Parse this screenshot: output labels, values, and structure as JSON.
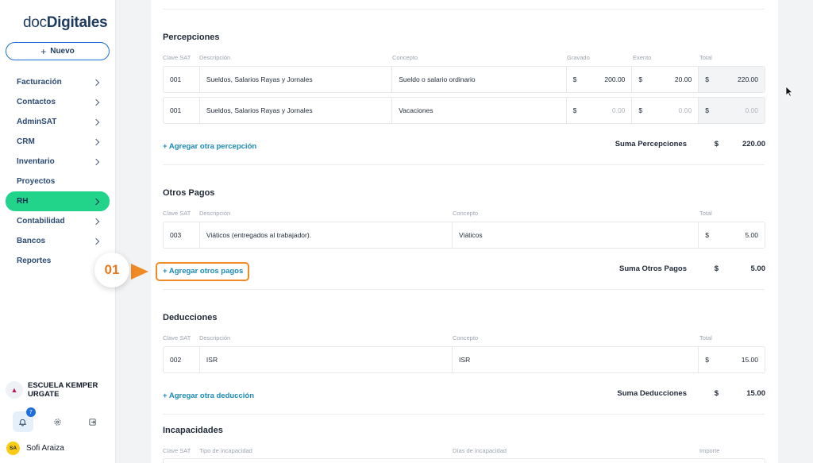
{
  "app": {
    "logo_light": "doc",
    "logo_bold": "Digitales"
  },
  "sidebar": {
    "new_button": "Nuevo",
    "items": [
      {
        "label": "Facturación",
        "chevron": true
      },
      {
        "label": "Contactos",
        "chevron": true
      },
      {
        "label": "AdminSAT",
        "chevron": true
      },
      {
        "label": "CRM",
        "chevron": true
      },
      {
        "label": "Inventario",
        "chevron": true
      },
      {
        "label": "Proyectos",
        "chevron": false
      },
      {
        "label": "RH",
        "chevron": true,
        "active": true
      },
      {
        "label": "Contabilidad",
        "chevron": true
      },
      {
        "label": "Bancos",
        "chevron": true
      },
      {
        "label": "Reportes",
        "chevron": false
      }
    ],
    "org_name_line1": "ESCUELA KEMPER",
    "org_name_line2": "URGATE",
    "notifications_count": "7",
    "user_initials": "SA",
    "user_name": "Sofi Araiza"
  },
  "percepciones": {
    "title": "Percepciones",
    "headers": {
      "clave": "Clave SAT",
      "descripcion": "Descripción",
      "concepto": "Concepto",
      "gravado": "Gravado",
      "exento": "Exento",
      "total": "Total"
    },
    "rows": [
      {
        "clave": "001",
        "descripcion": "Sueldos, Salarios Rayas y Jornales",
        "concepto": "Sueldo o salario ordinario",
        "currency": "$",
        "gravado": "200.00",
        "exento": "20.00",
        "total": "220.00"
      },
      {
        "clave": "001",
        "descripcion": "Sueldos, Salarios Rayas y Jornales",
        "concepto": "Vacaciones",
        "currency": "$",
        "gravado": "0.00",
        "exento": "0.00",
        "total": "0.00"
      }
    ],
    "add_link": "+ Agregar otra percepción",
    "sum_label": "Suma Percepciones",
    "sum_currency": "$",
    "sum_value": "220.00"
  },
  "otros_pagos": {
    "title": "Otros Pagos",
    "headers": {
      "clave": "Clave SAT",
      "descripcion": "Descripción",
      "concepto": "Concepto",
      "total": "Total"
    },
    "rows": [
      {
        "clave": "003",
        "descripcion": "Viáticos (entregados al trabajador).",
        "concepto": "Viáticos",
        "currency": "$",
        "total": "5.00"
      }
    ],
    "add_link": "+ Agregar otros pagos",
    "sum_label": "Suma Otros Pagos",
    "sum_currency": "$",
    "sum_value": "5.00"
  },
  "deducciones": {
    "title": "Deducciones",
    "headers": {
      "clave": "Clave SAT",
      "descripcion": "Descripción",
      "concepto": "Concepto",
      "total": "Total"
    },
    "rows": [
      {
        "clave": "002",
        "descripcion": "ISR",
        "concepto": "ISR",
        "currency": "$",
        "total": "15.00"
      }
    ],
    "add_link": "+ Agregar otra deducción",
    "sum_label": "Suma Deducciones",
    "sum_currency": "$",
    "sum_value": "15.00"
  },
  "incapacidades": {
    "title": "Incapacidades",
    "headers": {
      "clave": "Clave SAT",
      "tipo": "Tipo de incapacidad",
      "dias": "Días de incapacidad",
      "importe": "Importe"
    }
  },
  "callout": {
    "step": "01"
  },
  "colors": {
    "accent_green": "#22d38a",
    "link_blue": "#1b8ab8",
    "callout_orange": "#f08a24"
  }
}
